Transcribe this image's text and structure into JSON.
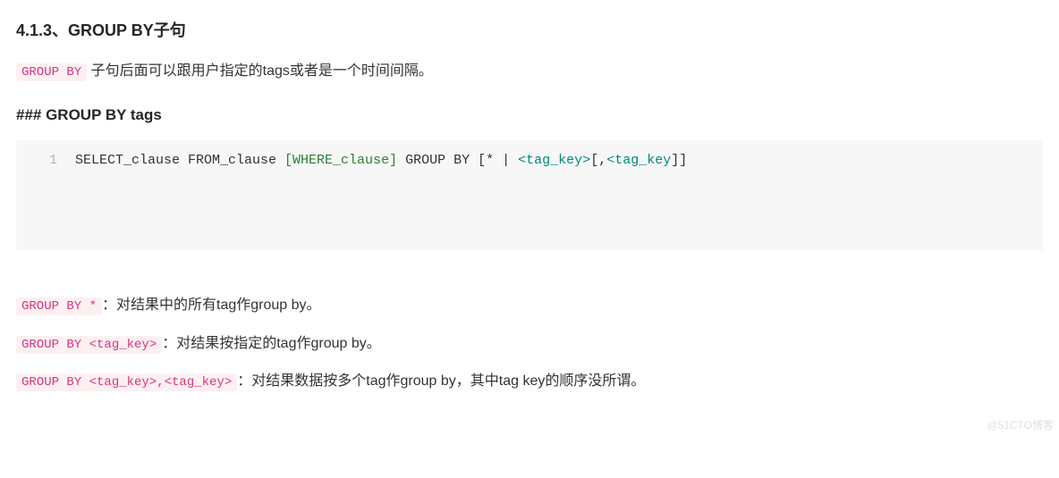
{
  "heading": "4.1.3、GROUP BY子句",
  "intro": {
    "code": "GROUP BY",
    "text": "子句后面可以跟用户指定的tags或者是一个时间间隔。"
  },
  "subheading": "### GROUP BY tags",
  "codeblock": {
    "line_number": "1",
    "segments": {
      "a": "SELECT_clause FROM_clause ",
      "b": "[WHERE_clause]",
      "c": " GROUP BY [",
      "d": "*",
      "e": " | ",
      "f": "<",
      "g": "tag_key",
      "h": ">",
      "i": "[,",
      "j": "<",
      "k": "tag_key",
      "l": "]]"
    }
  },
  "definitions": [
    {
      "code": "GROUP BY *",
      "desc": "：对结果中的所有tag作group by。"
    },
    {
      "code": "GROUP BY <tag_key>",
      "desc": "：对结果按指定的tag作group by。"
    },
    {
      "code": "GROUP BY <tag_key>,<tag_key>",
      "desc": "：对结果数据按多个tag作group by，其中tag key的顺序没所谓。"
    }
  ],
  "watermark": "@51CTO博客"
}
